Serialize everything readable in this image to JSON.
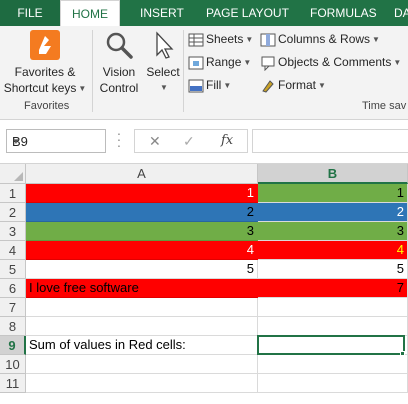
{
  "ribbon_tabs": [
    "FILE",
    "HOME",
    "INSERT",
    "PAGE LAYOUT",
    "FORMULAS",
    "DATA"
  ],
  "ribbon": {
    "favorites_line1": "Favorites &",
    "favorites_line2": "Shortcut keys",
    "vision_line1": "Vision",
    "vision_line2": "Control",
    "select_label": "Select",
    "sheets": "Sheets",
    "range": "Range",
    "fill": "Fill",
    "columns_rows": "Columns & Rows",
    "objects_comments": "Objects & Comments",
    "format": "Format",
    "group_favorites": "Favorites",
    "group_timesaver": "Time sav"
  },
  "formula_bar": {
    "name_box": "B9",
    "cancel_symbol": "✕",
    "enter_symbol": "✓",
    "fx_symbol": "fx",
    "formula": ""
  },
  "grid": {
    "columns": [
      "A",
      "B"
    ],
    "selected_column": "B",
    "selected_row": "9",
    "row_numbers": [
      "1",
      "2",
      "3",
      "4",
      "5",
      "6",
      "7",
      "8",
      "9",
      "10",
      "11"
    ],
    "rows": [
      {
        "a": "1",
        "b": "1",
        "a_bg": "#ff0000",
        "a_fg": "#ffffff",
        "b_bg": "#70ad47",
        "b_fg": "#000000"
      },
      {
        "a": "2",
        "b": "2",
        "a_bg": "#2e75b6",
        "a_fg": "#000000",
        "b_bg": "#2e75b6",
        "b_fg": "#ffffff"
      },
      {
        "a": "3",
        "b": "3",
        "a_bg": "#70ad47",
        "a_fg": "#000000",
        "b_bg": "#70ad47",
        "b_fg": "#000000"
      },
      {
        "a": "4",
        "b": "4",
        "a_bg": "#ff0000",
        "a_fg": "#ffffff",
        "b_bg": "#ff0000",
        "b_fg": "#ffff00"
      },
      {
        "a": "5",
        "b": "5",
        "a_bg": "#ffffff",
        "a_fg": "#000000",
        "b_bg": "#ffffff",
        "b_fg": "#000000"
      },
      {
        "a": "I love free software",
        "b": "7",
        "a_bg": "#ff0000",
        "a_fg": "#000000",
        "b_bg": "#ff0000",
        "b_fg": "#000000"
      },
      {
        "a": "",
        "b": "",
        "a_bg": "#ffffff",
        "a_fg": "#000000",
        "b_bg": "#ffffff",
        "b_fg": "#000000"
      },
      {
        "a": "",
        "b": "",
        "a_bg": "#ffffff",
        "a_fg": "#000000",
        "b_bg": "#ffffff",
        "b_fg": "#000000"
      },
      {
        "a": "Sum of values in Red cells:",
        "b": "",
        "a_bg": "#ffffff",
        "a_fg": "#000000",
        "b_bg": "#ffffff",
        "b_fg": "#000000"
      },
      {
        "a": "",
        "b": "",
        "a_bg": "#ffffff",
        "a_fg": "#000000",
        "b_bg": "#ffffff",
        "b_fg": "#000000"
      },
      {
        "a": "",
        "b": "",
        "a_bg": "#ffffff",
        "a_fg": "#000000",
        "b_bg": "#ffffff",
        "b_fg": "#000000"
      }
    ]
  },
  "colors": {
    "excel_green": "#217346",
    "red": "#ff0000",
    "blue": "#2e75b6",
    "green": "#70ad47",
    "yellow": "#ffff00"
  }
}
